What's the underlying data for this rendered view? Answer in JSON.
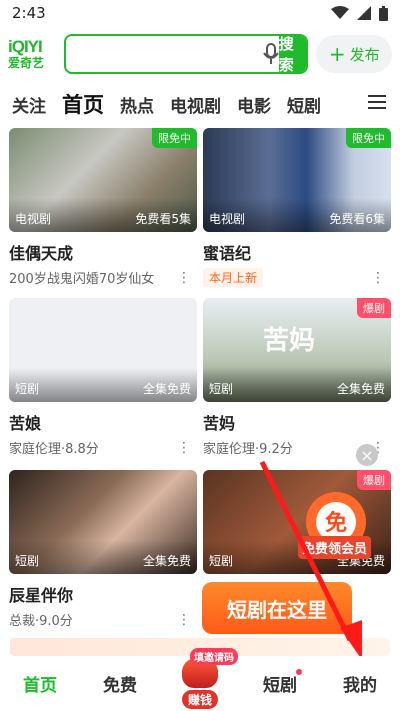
{
  "status": {
    "time": "2:43"
  },
  "header": {
    "logo_top": "iQIYI",
    "logo_bottom": "爱奇艺",
    "search_placeholder": "",
    "search_button": "搜索",
    "publish_label": "发布"
  },
  "tabs": [
    "关注",
    "首页",
    "热点",
    "电视剧",
    "电影",
    "短剧"
  ],
  "cards": [
    {
      "title": "佳偶天成",
      "sub": "200岁战鬼闪婚70岁仙女",
      "category": "电视剧",
      "episodes": "免费看5集",
      "badge": "限免中"
    },
    {
      "title": "蜜语纪",
      "sub": "本月上新",
      "category": "电视剧",
      "episodes": "免费看6集",
      "badge": "限免中"
    },
    {
      "title": "苦娘",
      "sub": "家庭伦理·8.8分",
      "category": "短剧",
      "episodes": "全集免费",
      "badge": ""
    },
    {
      "title": "苦妈",
      "sub": "家庭伦理·9.2分",
      "category": "短剧",
      "episodes": "全集免费",
      "badge": "爆剧",
      "poster_text": "苦妈"
    },
    {
      "title": "辰星伴你",
      "sub": "总裁·9.0分",
      "category": "短剧",
      "episodes": "全集免费",
      "badge": ""
    },
    {
      "title": "",
      "sub": "",
      "category": "短剧",
      "episodes": "全集免费",
      "badge": "爆剧"
    }
  ],
  "promo": {
    "coupon_label": "免费领会员",
    "banner": "短剧在这里"
  },
  "bottom_nav": {
    "home": "首页",
    "free": "免费",
    "earn": "赚钱",
    "earn_invite": "填邀请码",
    "short": "短剧",
    "mine": "我的"
  },
  "colors": {
    "brand": "#1fbb2c",
    "hot": "#ff4f6a",
    "accent_orange": "#ff6a1f"
  }
}
